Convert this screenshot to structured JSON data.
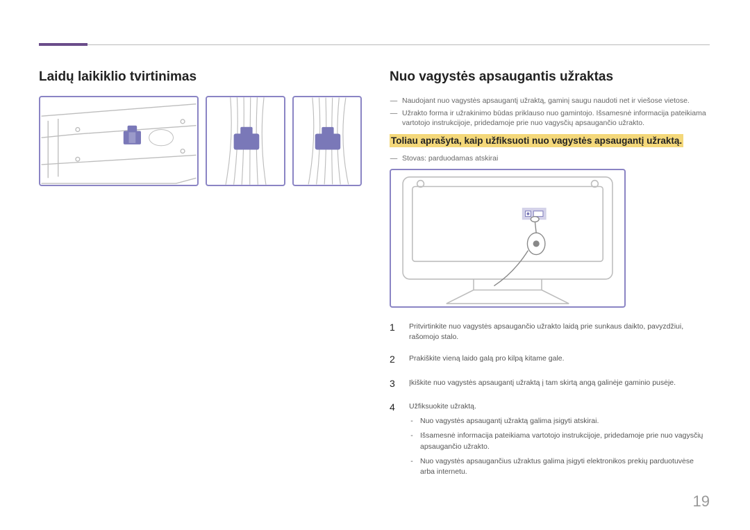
{
  "left": {
    "heading": "Laidų laikiklio tvirtinimas"
  },
  "right": {
    "heading": "Nuo vagystės apsaugantis užraktas",
    "dash1": "Naudojant nuo vagystės apsaugantį užraktą, gaminį saugu naudoti net ir viešose vietose.",
    "dash2": "Užrakto forma ir užrakinimo būdas priklauso nuo gamintojo. Išsamesnė informacija pateikiama vartotojo instrukcijoje, pridedamoje prie nuo vagysčių apsaugančio užrakto.",
    "highlightText": "Toliau aprašyta, kaip užfiksuoti nuo vagystės apsaugantį užraktą.",
    "dash3": "Stovas: parduodamas atskirai",
    "steps": {
      "s1": "Pritvirtinkite nuo vagystės apsaugančio užrakto laidą prie sunkaus daikto, pavyzdžiui, rašomojo stalo.",
      "s2": "Prakiškite vieną laido galą pro kilpą kitame gale.",
      "s3": "Įkiškite nuo vagystės apsaugantį užraktą į tam skirtą angą galinėje gaminio pusėje.",
      "s4": "Užfiksuokite užraktą.",
      "sub1": "Nuo vagystės apsaugantį užraktą galima įsigyti atskirai.",
      "sub2": "Išsamesnė informacija pateikiama vartotojo instrukcijoje, pridedamoje prie nuo vagysčių apsaugančio užrakto.",
      "sub3": "Nuo vagystės apsaugančius užraktus galima įsigyti elektronikos prekių parduotuvėse arba internetu."
    }
  },
  "pageNumber": "19",
  "nums": {
    "n1": "1",
    "n2": "2",
    "n3": "3",
    "n4": "4"
  },
  "marks": {
    "dash": "―",
    "hyphen": "-"
  }
}
